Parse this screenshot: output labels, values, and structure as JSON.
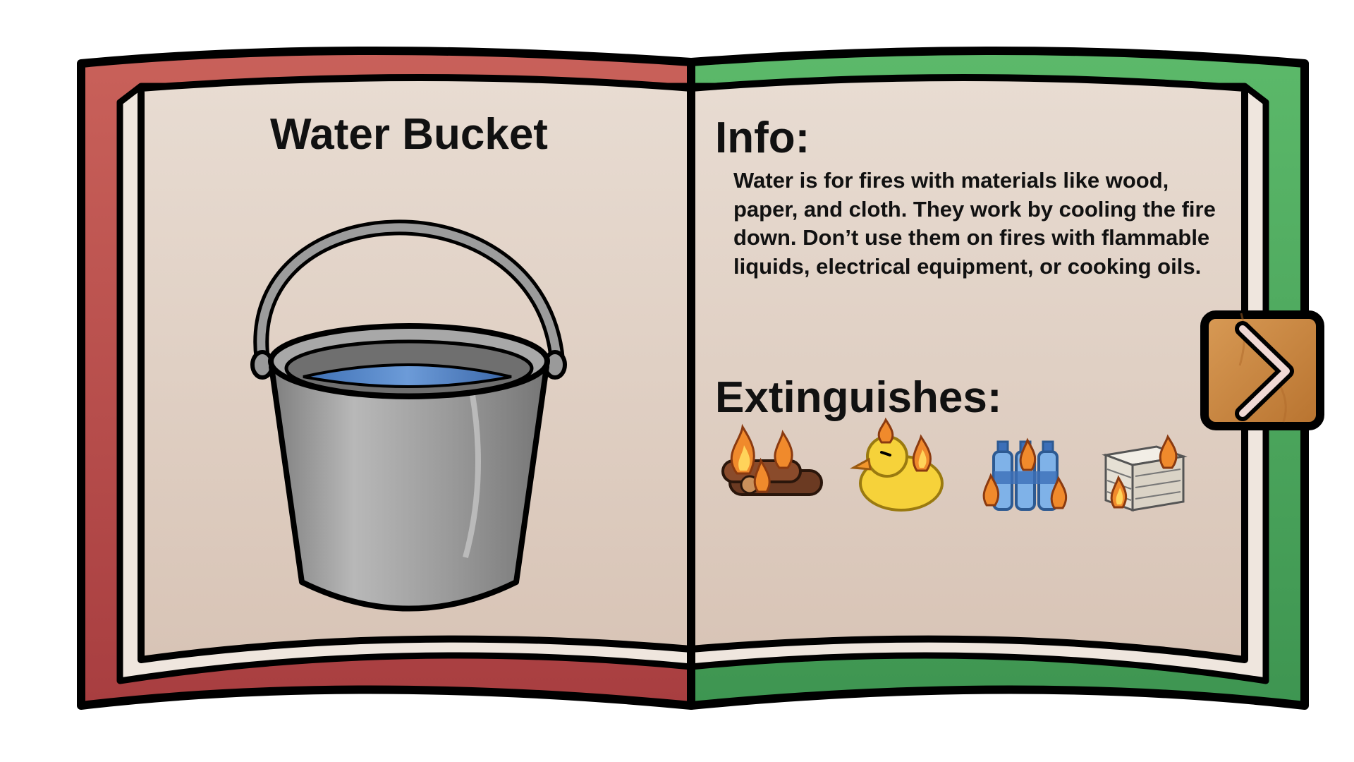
{
  "item": {
    "title": "Water Bucket",
    "image_icon": "water-bucket-icon"
  },
  "info": {
    "heading": "Info:",
    "text": "Water is for fires with materials like wood, paper, and cloth. They work by cooling the fire down. Don’t use them on fires with flammable liquids, electrical equipment, or cooking oils."
  },
  "extinguishes": {
    "heading": "Extinguishes:",
    "icons": [
      "burning-logs-icon",
      "burning-rubber-duck-icon",
      "burning-plastic-bottles-icon",
      "burning-paper-stack-icon"
    ]
  },
  "navigation": {
    "next_icon": "chevron-right-icon"
  },
  "colors": {
    "cover_left": "#B94A48",
    "cover_right": "#4FAA5E",
    "page": "#E6D8CD",
    "outline": "#000000",
    "next_button": "#C8843F"
  }
}
